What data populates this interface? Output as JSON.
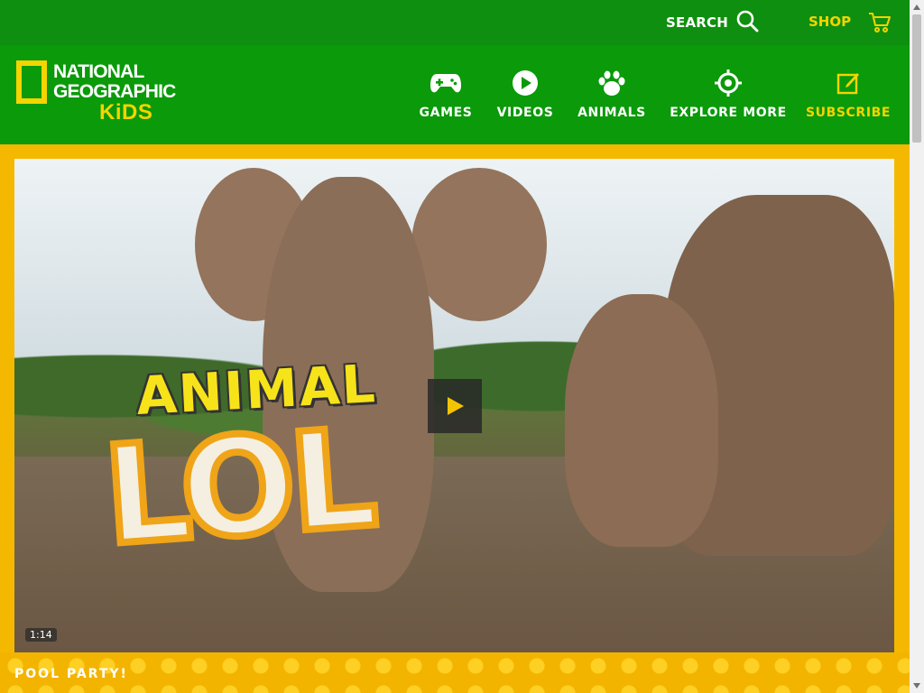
{
  "topbar": {
    "search_label": "SEARCH",
    "shop_label": "SHOP",
    "search_icon": "search-icon",
    "cart_icon": "cart-icon"
  },
  "logo": {
    "line1": "NATIONAL",
    "line2": "GEOGRAPHIC",
    "line3": "KiDS"
  },
  "nav": {
    "items": [
      {
        "label": "GAMES",
        "icon": "gamepad-icon"
      },
      {
        "label": "VIDEOS",
        "icon": "play-circle-icon"
      },
      {
        "label": "ANIMALS",
        "icon": "paw-icon"
      },
      {
        "label": "EXPLORE MORE",
        "icon": "target-icon"
      },
      {
        "label": "SUBSCRIBE",
        "icon": "edit-icon"
      }
    ]
  },
  "video": {
    "title_line1": "ANIMAL",
    "title_line2": "LOL",
    "duration": "1:14",
    "caption": "POOL PARTY!"
  },
  "colors": {
    "header_green": "#0a9a0a",
    "topbar_green": "#0f8f0f",
    "accent_yellow": "#f5d400",
    "band_yellow": "#f5b800"
  }
}
